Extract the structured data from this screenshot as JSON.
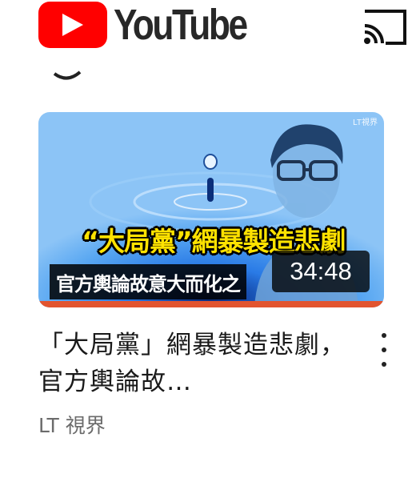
{
  "header": {
    "logo_text": "YouTube",
    "icons": [
      "youtube-play-icon",
      "cast-icon"
    ]
  },
  "video": {
    "thumbnail": {
      "watermark": "LT視界",
      "caption_main": "“大局黨”網暴製造悲劇",
      "caption_sub": "官方輿論故意大而化之",
      "duration": "34:48",
      "watch_progress": 1.0
    },
    "title": "「大局黨」網暴製造悲劇，官方輿論故…",
    "channel": "LT 視界"
  },
  "colors": {
    "brand_red": "#ff0000",
    "progress_red": "#e2542f",
    "caption_yellow": "#ffe200"
  }
}
